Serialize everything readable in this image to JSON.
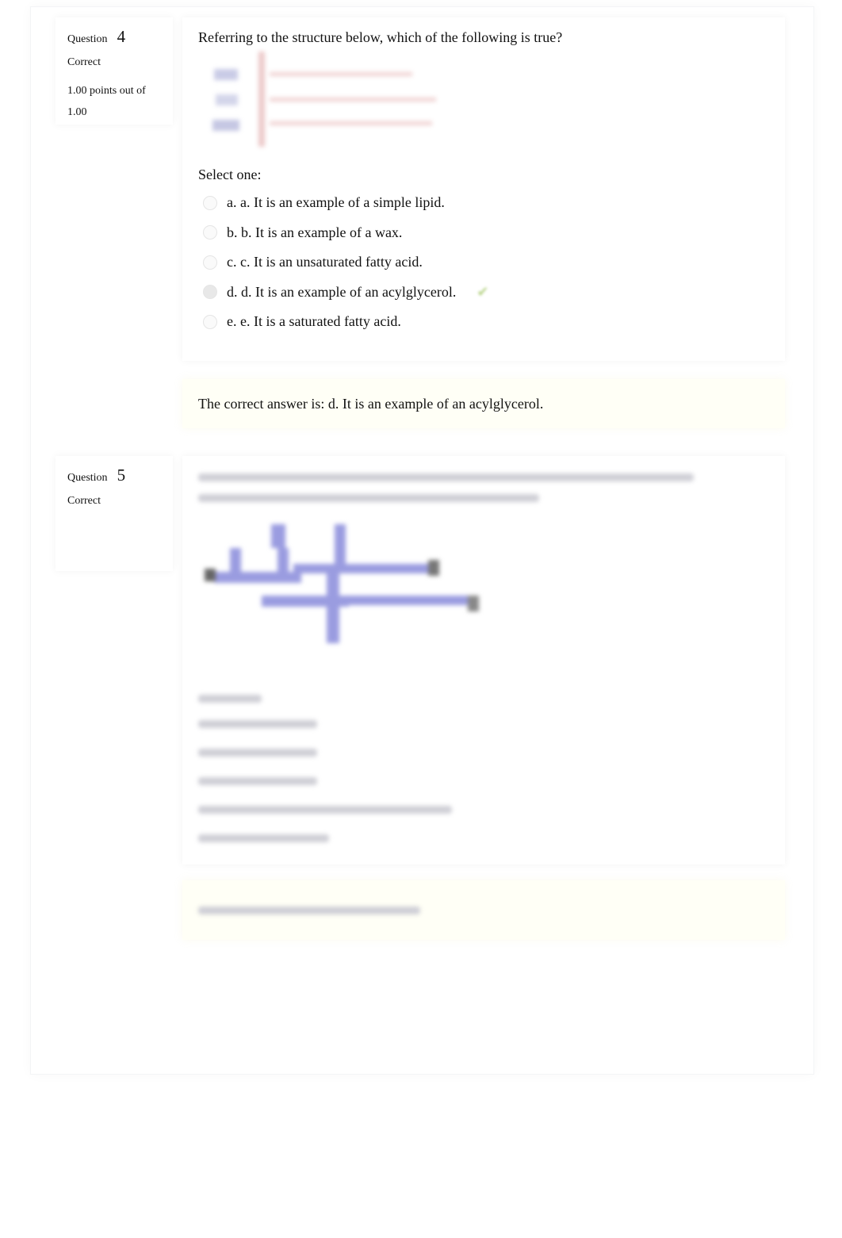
{
  "questions": [
    {
      "label": "Question",
      "number": "4",
      "state": "Correct",
      "grade": "1.00 points out of 1.00",
      "text": "Referring to the structure below, which of the following is true?",
      "prompt": "Select one:",
      "options": [
        {
          "label": "a. a. It is an example of a simple lipid.",
          "selected": false
        },
        {
          "label": "b. b. It is an example of a wax.",
          "selected": false
        },
        {
          "label": "c. c. It is an unsaturated fatty acid.",
          "selected": false
        },
        {
          "label": "d. d. It is an example of an acylglycerol.",
          "selected": true,
          "correct": true,
          "icon": "check-icon"
        },
        {
          "label": "e. e. It is a saturated fatty acid.",
          "selected": false
        }
      ],
      "feedback": "The correct answer is: d. It is an example of an acylglycerol."
    },
    {
      "label": "Question",
      "number": "5",
      "state": "Correct"
    }
  ],
  "colors": {
    "tick": "#b9d48a",
    "feedback_bg": "#fffff6",
    "structure_blue": "#8a8ad6",
    "structure_red": "#e9b8b8"
  }
}
